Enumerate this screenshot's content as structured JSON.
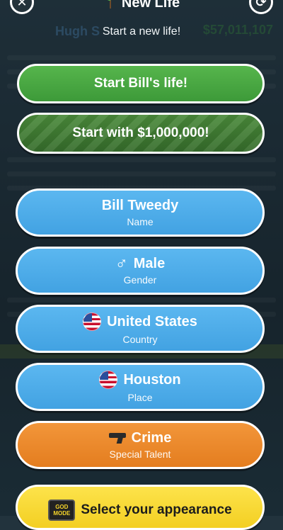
{
  "header": {
    "title": "New Life",
    "subtitle": "Start a new life!",
    "close_icon": "close-icon",
    "random_icon": "shuffle-icon"
  },
  "background": {
    "name": "Hugh S",
    "money": "$57,011,107"
  },
  "buttons": {
    "start_life": "Start Bill's life!",
    "start_money": "Start with $1,000,000!",
    "name": {
      "value": "Bill Tweedy",
      "label": "Name"
    },
    "gender": {
      "value": "Male",
      "label": "Gender"
    },
    "country": {
      "value": "United States",
      "label": "Country"
    },
    "place": {
      "value": "Houston",
      "label": "Place"
    },
    "talent": {
      "value": "Crime",
      "label": "Special Talent"
    },
    "appearance": {
      "value": "Select your appearance",
      "badge_line1": "GOD",
      "badge_line2": "MODE"
    }
  },
  "colors": {
    "green": "#3d9a39",
    "blue": "#4aa9e8",
    "orange": "#ec8a2b",
    "yellow": "#f8d937"
  }
}
